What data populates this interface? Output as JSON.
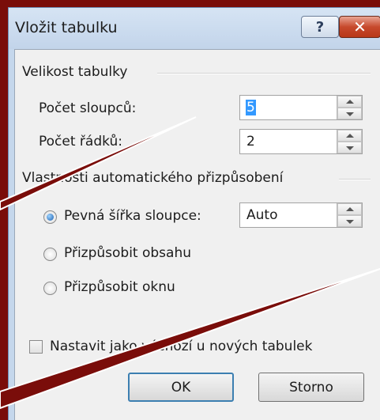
{
  "window": {
    "title": "Vložit tabulku",
    "help_label": "?",
    "close_label": "✕"
  },
  "table_size": {
    "group_label": "Velikost tabulky",
    "columns_label": "Počet sloupců:",
    "columns_value": "5",
    "rows_label": "Počet řádků:",
    "rows_value": "2"
  },
  "autofit": {
    "group_label": "Vlastnosti automatického přizpůsobení",
    "options": [
      {
        "label": "Pevná šířka sloupce:",
        "checked": true
      },
      {
        "label": "Přizpůsobit obsahu",
        "checked": false
      },
      {
        "label": "Přizpůsobit oknu",
        "checked": false
      }
    ],
    "fixed_width_value": "Auto"
  },
  "remember_label": "Nastavit jako výchozí u nových tabulek",
  "buttons": {
    "ok": "OK",
    "cancel": "Storno"
  },
  "colors": {
    "background": "#7a0d0a",
    "callout_line": "#ffffff"
  }
}
